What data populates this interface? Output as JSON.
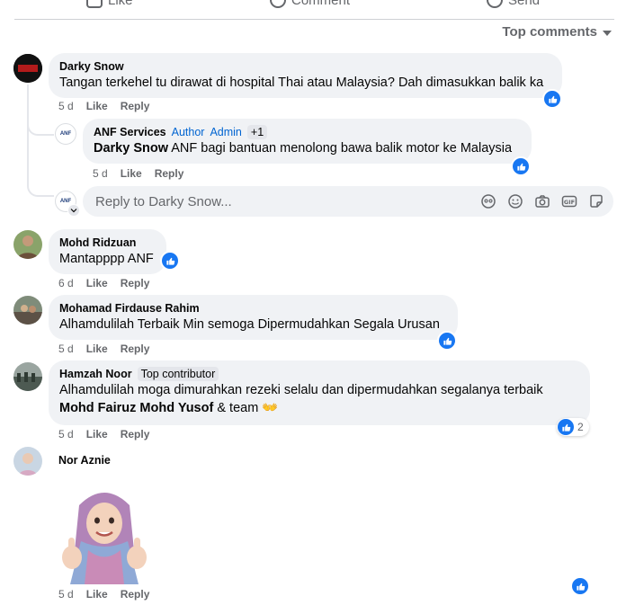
{
  "top_actions": {
    "like": "Like",
    "comment": "Comment",
    "send": "Send"
  },
  "sort_label": "Top comments",
  "like_label": "Like",
  "reply_label": "Reply",
  "comments": [
    {
      "author": "Darky Snow",
      "text": "Tangan terkehel tu dirawat di hospital Thai atau Malaysia? Dah dimasukkan balik ka",
      "time": "5 d",
      "reply": {
        "author": "ANF Services",
        "badge_author": "Author",
        "badge_admin": "Admin",
        "badge_extra": "+1",
        "mention": "Darky Snow",
        "text": " ANF bagi bantuan menolong bawa balik motor ke Malaysia",
        "time": "5 d"
      },
      "reply_placeholder": "Reply to Darky Snow...",
      "avatar_text": "DARKY"
    },
    {
      "author": "Mohd Ridzuan",
      "text": "Mantapppp ANF",
      "time": "6 d"
    },
    {
      "author": "Mohamad Firdause Rahim",
      "text": "Alhamdulilah Terbaik Min semoga Dipermudahkan Segala Urusan",
      "time": "5 d"
    },
    {
      "author": "Hamzah Noor",
      "badge": "Top contributor",
      "text1": "Alhamdulilah moga dimurahkan rezeki selalu dan dipermudahkan segalanya terbaik",
      "mention": "Mohd Fairuz Mohd Yusof",
      "text2": " & team ",
      "emoji": "👐",
      "reactions": "2",
      "time": "5 d"
    },
    {
      "author": "Nor Aznie",
      "time": "5 d"
    }
  ],
  "anf_logo_text": "ANF",
  "colors": {
    "accent": "#1877f2",
    "bubble": "#f0f2f5",
    "meta": "#65676b"
  }
}
